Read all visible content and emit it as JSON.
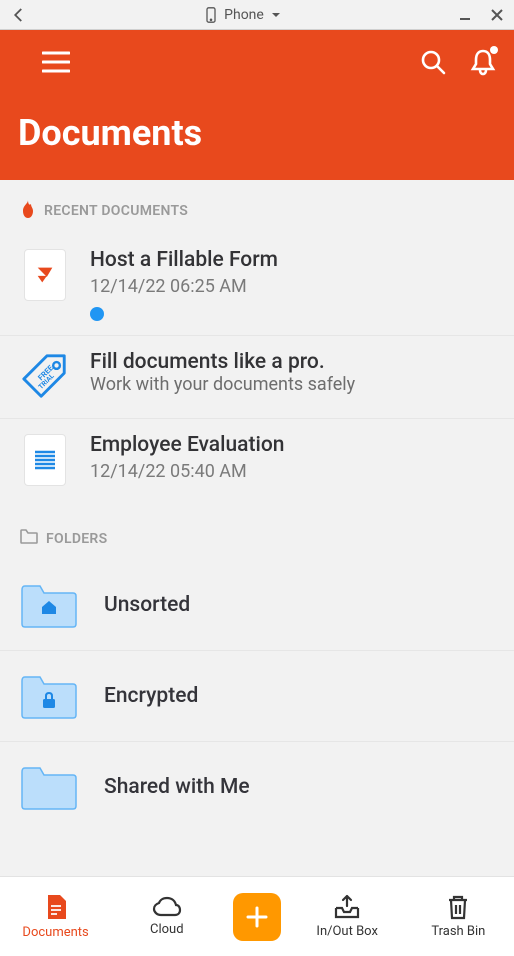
{
  "window": {
    "device_label": "Phone"
  },
  "header": {
    "title": "Documents"
  },
  "sections": {
    "recent_label": "RECENT DOCUMENTS",
    "folders_label": "FOLDERS"
  },
  "recent": [
    {
      "title": "Host a Fillable Form",
      "subtitle": "12/14/22 06:25 AM",
      "has_status_dot": true,
      "icon": "pdf"
    }
  ],
  "promo": {
    "title": "Fill documents like a pro.",
    "subtitle": "Work with your documents safely"
  },
  "recent2": [
    {
      "title": "Employee Evaluation",
      "subtitle": "12/14/22 05:40 AM",
      "icon": "text"
    }
  ],
  "folders": [
    {
      "title": "Unsorted",
      "icon": "home"
    },
    {
      "title": "Encrypted",
      "icon": "lock"
    },
    {
      "title": "Shared with Me",
      "icon": "shared"
    }
  ],
  "bottomnav": {
    "documents": "Documents",
    "cloud": "Cloud",
    "inout": "In/Out Box",
    "trash": "Trash Bin"
  }
}
